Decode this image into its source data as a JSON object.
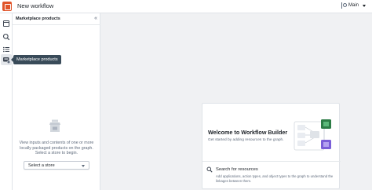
{
  "header": {
    "title": "New workflow",
    "branch": "Main"
  },
  "rail": {
    "items": [
      {
        "icon": "document-icon"
      },
      {
        "icon": "search-icon"
      },
      {
        "icon": "list-icon"
      },
      {
        "icon": "marketplace-icon",
        "active": true
      }
    ],
    "tooltip": "Marketplace products"
  },
  "panel": {
    "title": "Marketplace products",
    "empty_message": "View inputs and contents of one or more locally packaged products on the graph. Select a store to begin.",
    "select_placeholder": "Select a store"
  },
  "welcome": {
    "title": "Welcome to Workflow Builder",
    "subtitle": "Get started by adding resources to the graph.",
    "link_title": "Search for resources",
    "link_desc": "Add applications, action types, and object types to the graph to understand the linkages between them."
  },
  "colors": {
    "brand": "#e0552a",
    "accent_green": "#2d7d46",
    "accent_purple": "#7a5fd8"
  }
}
